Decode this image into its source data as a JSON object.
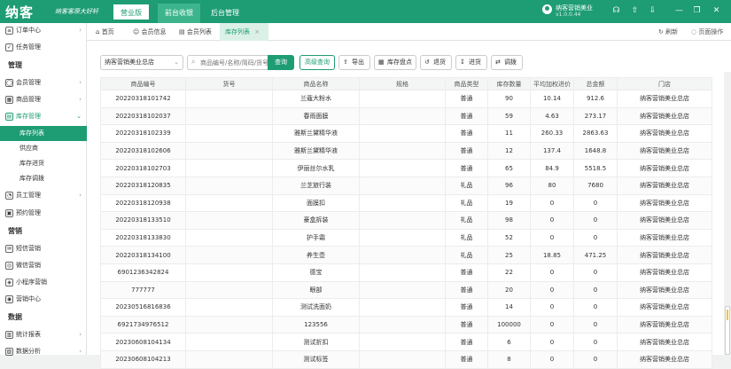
{
  "header": {
    "logo": "纳客",
    "slogan": "纳客客原大好轩",
    "mode_button": "营业版",
    "nav_tabs": [
      "前台收银",
      "后台管理"
    ],
    "store_name": "纳客营销美业",
    "version": "v1.0.0.44",
    "icons": [
      "headset-icon",
      "upload-icon",
      "download-icon",
      "minimize-icon",
      "restore-icon",
      "close-icon"
    ]
  },
  "sidebar": {
    "items_top": [
      {
        "label": "订单中心",
        "icon": "order-icon"
      },
      {
        "label": "任务管理",
        "icon": "task-icon"
      }
    ],
    "group_manage": "管理",
    "items_manage": [
      {
        "label": "会员管理",
        "icon": "member-icon"
      },
      {
        "label": "商品管理",
        "icon": "goods-icon"
      },
      {
        "label": "库存管理",
        "icon": "stock-icon"
      }
    ],
    "stock_sub": [
      "库存列表",
      "供应商",
      "库存进货",
      "库存调拨"
    ],
    "items_staff": [
      {
        "label": "员工管理",
        "icon": "staff-icon"
      },
      {
        "label": "预约管理",
        "icon": "booking-icon"
      }
    ],
    "group_marketing": "营销",
    "items_marketing": [
      {
        "label": "短信营销",
        "icon": "sms-icon"
      },
      {
        "label": "微信营销",
        "icon": "wechat-icon"
      },
      {
        "label": "小程序营销",
        "icon": "miniapp-icon"
      },
      {
        "label": "营销中心",
        "icon": "marketing-icon"
      }
    ],
    "group_data": "数据",
    "items_data": [
      {
        "label": "统计报表",
        "icon": "report-icon"
      },
      {
        "label": "数据分析",
        "icon": "analysis-icon"
      }
    ]
  },
  "tabs": {
    "items": [
      "首页",
      "会员信息",
      "会员列表",
      "库存列表"
    ],
    "refresh": "刷新",
    "page_ops": "页面操作"
  },
  "toolbar": {
    "store": "纳客营销美业总店",
    "search_placeholder": "商品编号/名称/简码/货号",
    "search_label": "查询",
    "buttons": [
      "高级查询",
      "导出",
      "库存盘点",
      "退货",
      "进货",
      "调拨"
    ]
  },
  "table": {
    "columns": [
      "商品编号",
      "货号",
      "商品名称",
      "规格",
      "商品类型",
      "库存数量",
      "平均加权进价",
      "总金额",
      "门店"
    ],
    "rows": [
      [
        "20220318101742",
        "",
        "兰蔻大粉水",
        "",
        "普通",
        "90",
        "10.14",
        "912.6",
        "纳客营销美业总店"
      ],
      [
        "20220318102037",
        "",
        "春雨面膜",
        "",
        "普通",
        "59",
        "4.63",
        "273.17",
        "纳客营销美业总店"
      ],
      [
        "20220318102339",
        "",
        "雅斯兰黛精华液",
        "",
        "普通",
        "11",
        "260.33",
        "2863.63",
        "纳客营销美业总店"
      ],
      [
        "20220318102606",
        "",
        "雅斯兰黛精华液",
        "",
        "普通",
        "12",
        "137.4",
        "1648.8",
        "纳客营销美业总店"
      ],
      [
        "20220318102703",
        "",
        "伊丽丝尔水乳",
        "",
        "普通",
        "65",
        "84.9",
        "5518.5",
        "纳客营销美业总店"
      ],
      [
        "20220318120835",
        "",
        "兰芝旅行装",
        "",
        "礼品",
        "96",
        "80",
        "7680",
        "纳客营销美业总店"
      ],
      [
        "20220318120938",
        "",
        "面膜扣",
        "",
        "礼品",
        "19",
        "0",
        "0",
        "纳客营销美业总店"
      ],
      [
        "20220318133510",
        "",
        "豪盒拆装",
        "",
        "礼品",
        "98",
        "0",
        "0",
        "纳客营销美业总店"
      ],
      [
        "20220318133830",
        "",
        "护手霜",
        "",
        "礼品",
        "52",
        "0",
        "0",
        "纳客营销美业总店"
      ],
      [
        "20220318134100",
        "",
        "养生壶",
        "",
        "礼品",
        "25",
        "18.85",
        "471.25",
        "纳客营销美业总店"
      ],
      [
        "6901236342824",
        "",
        "德宝",
        "",
        "普通",
        "22",
        "0",
        "0",
        "纳客营销美业总店"
      ],
      [
        "777777",
        "",
        "眼部",
        "",
        "普通",
        "20",
        "0",
        "0",
        "纳客营销美业总店"
      ],
      [
        "20230516816836",
        "",
        "测试洗面奶",
        "",
        "普通",
        "14",
        "0",
        "0",
        "纳客营销美业总店"
      ],
      [
        "6921734976512",
        "",
        "123556",
        "",
        "普通",
        "100000",
        "0",
        "0",
        "纳客营销美业总店"
      ],
      [
        "20230608104134",
        "",
        "测试折扣",
        "",
        "普通",
        "6",
        "0",
        "0",
        "纳客营销美业总店"
      ],
      [
        "20230608104213",
        "",
        "测试标签",
        "",
        "普通",
        "8",
        "0",
        "0",
        "纳客营销美业总店"
      ]
    ]
  }
}
